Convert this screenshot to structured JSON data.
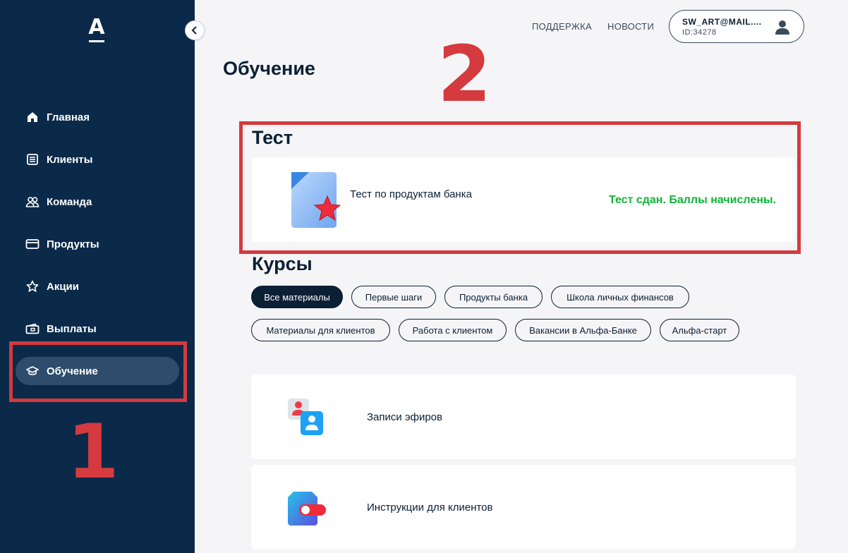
{
  "sidebar": {
    "logo_letter": "А",
    "items": [
      {
        "label": "Главная",
        "icon": "home-icon"
      },
      {
        "label": "Клиенты",
        "icon": "clients-list-icon"
      },
      {
        "label": "Команда",
        "icon": "team-icon"
      },
      {
        "label": "Продукты",
        "icon": "card-icon"
      },
      {
        "label": "Акции",
        "icon": "star-icon"
      },
      {
        "label": "Выплаты",
        "icon": "wallet-icon"
      },
      {
        "label": "Обучение",
        "icon": "graduation-cap-icon",
        "active": true
      }
    ]
  },
  "header": {
    "support": "ПОДДЕРЖКА",
    "news": "НОВОСТИ",
    "user_email": "SW_ART@MAIL....",
    "user_id": "ID:34278"
  },
  "page": {
    "title": "Обучение"
  },
  "test_section": {
    "title": "Тест",
    "card": {
      "name": "Тест по продуктам банка",
      "status": "Тест сдан. Баллы начислены."
    }
  },
  "courses_section": {
    "title": "Курсы",
    "filters": [
      "Все материалы",
      "Первые шаги",
      "Продукты банка",
      "Школа личных финансов",
      "Материалы для клиентов",
      "Работа с клиентом",
      "Вакансии в Альфа-Банке",
      "Альфа-старт"
    ],
    "active_filter": "Все материалы",
    "cards": [
      {
        "label": "Записи эфиров",
        "icon": "broadcast-records-icon"
      },
      {
        "label": "Инструкции для клиентов",
        "icon": "client-instructions-icon"
      }
    ]
  },
  "annotations": {
    "first": "1",
    "second": "2",
    "color": "#d43a3e"
  },
  "colors": {
    "sidebar_bg": "#0b2a4a",
    "active_item_bg": "#2e4d6c",
    "status_green": "#12b33a",
    "primary_dark": "#0b1f35"
  }
}
